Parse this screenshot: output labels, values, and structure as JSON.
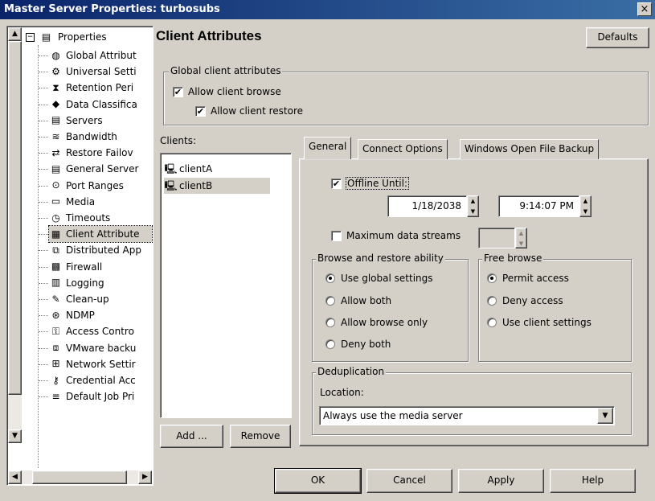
{
  "window": {
    "title": "Master Server Properties: turbosubs",
    "close_glyph": "×"
  },
  "tree": {
    "root": {
      "label": "Properties",
      "icon": "properties-icon"
    },
    "items": [
      {
        "label": "Global Attribut",
        "icon": "globe-icon"
      },
      {
        "label": "Universal Setti",
        "icon": "settings-icon"
      },
      {
        "label": "Retention Peri",
        "icon": "retention-icon"
      },
      {
        "label": "Data Classifica",
        "icon": "classification-icon"
      },
      {
        "label": "Servers",
        "icon": "server-icon"
      },
      {
        "label": "Bandwidth",
        "icon": "bandwidth-icon"
      },
      {
        "label": "Restore Failov",
        "icon": "failover-icon"
      },
      {
        "label": "General Server",
        "icon": "server-icon"
      },
      {
        "label": "Port Ranges",
        "icon": "port-icon"
      },
      {
        "label": "Media",
        "icon": "media-icon"
      },
      {
        "label": "Timeouts",
        "icon": "clock-icon"
      },
      {
        "label": "Client Attribute",
        "icon": "client-attributes-icon"
      },
      {
        "label": "Distributed App",
        "icon": "distributed-icon"
      },
      {
        "label": "Firewall",
        "icon": "firewall-icon"
      },
      {
        "label": "Logging",
        "icon": "logging-icon"
      },
      {
        "label": "Clean-up",
        "icon": "cleanup-icon"
      },
      {
        "label": "NDMP",
        "icon": "ndmp-icon"
      },
      {
        "label": "Access Contro",
        "icon": "access-control-icon"
      },
      {
        "label": "VMware backu",
        "icon": "vmware-icon"
      },
      {
        "label": "Network Settir",
        "icon": "network-icon"
      },
      {
        "label": "Credential Acc",
        "icon": "credential-icon"
      },
      {
        "label": "Default Job Pri",
        "icon": "job-priority-icon"
      }
    ]
  },
  "main": {
    "heading": "Client Attributes",
    "defaults_button": "Defaults",
    "global_group": {
      "legend": "Global client attributes",
      "allow_browse": {
        "label": "Allow client browse",
        "checked": true
      },
      "allow_restore": {
        "label": "Allow client restore",
        "checked": true
      }
    },
    "clients": {
      "label": "Clients:",
      "items": [
        "clientA",
        "clientB"
      ],
      "add_button": "Add ...",
      "remove_button": "Remove"
    },
    "tabs": [
      "General",
      "Connect Options",
      "Windows Open File Backup"
    ],
    "general": {
      "offline_until": {
        "label": "Offline Until:",
        "checked": true,
        "date": "1/18/2038",
        "time": "9:14:07 PM"
      },
      "max_streams": {
        "label": "Maximum data streams",
        "checked": false
      },
      "browse_restore": {
        "legend": "Browse and restore ability",
        "options": [
          "Use global settings",
          "Allow both",
          "Allow browse only",
          "Deny both"
        ],
        "selected": "Use global settings"
      },
      "free_browse": {
        "legend": "Free browse",
        "options": [
          "Permit access",
          "Deny access",
          "Use client settings"
        ],
        "selected": "Permit access"
      },
      "dedup": {
        "legend": "Deduplication",
        "location_label": "Location:",
        "location_value": "Always use the media server"
      }
    }
  },
  "footer": {
    "ok": "OK",
    "cancel": "Cancel",
    "apply": "Apply",
    "help": "Help"
  },
  "colors": {
    "titlebar": "#0a246a",
    "face": "#d4d0c8"
  }
}
